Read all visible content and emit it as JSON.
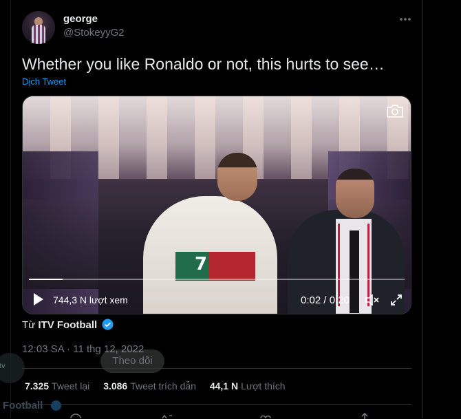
{
  "tweet": {
    "display_name": "george",
    "handle": "@StokeyyG2",
    "more_icon": "more-dots-icon",
    "text": "Whether you like Ronaldo or not, this hurts to see…",
    "translate_label": "Dịch Tweet",
    "timestamp": "12:03 SA · 11 thg 12, 2022"
  },
  "video": {
    "views": "744,3 N lượt xem",
    "time": "0:02 / 0:20",
    "progress": 0.09,
    "jersey_number": "7"
  },
  "source": {
    "prefix": "Từ",
    "name": "ITV Football"
  },
  "overlay": {
    "follow_label": "Theo dõi",
    "ghost_logo_text": "itv",
    "ghost_account_name": "Football"
  },
  "stats": [
    {
      "count": "7.325",
      "label": "Tweet lại"
    },
    {
      "count": "3.086",
      "label": "Tweet trích dẫn"
    },
    {
      "count": "44,1 N",
      "label": "Lượt thích"
    }
  ],
  "colors": {
    "accent": "#1d9bf0",
    "text": "#e7e9ea",
    "muted": "#71767b",
    "background": "#000000"
  }
}
